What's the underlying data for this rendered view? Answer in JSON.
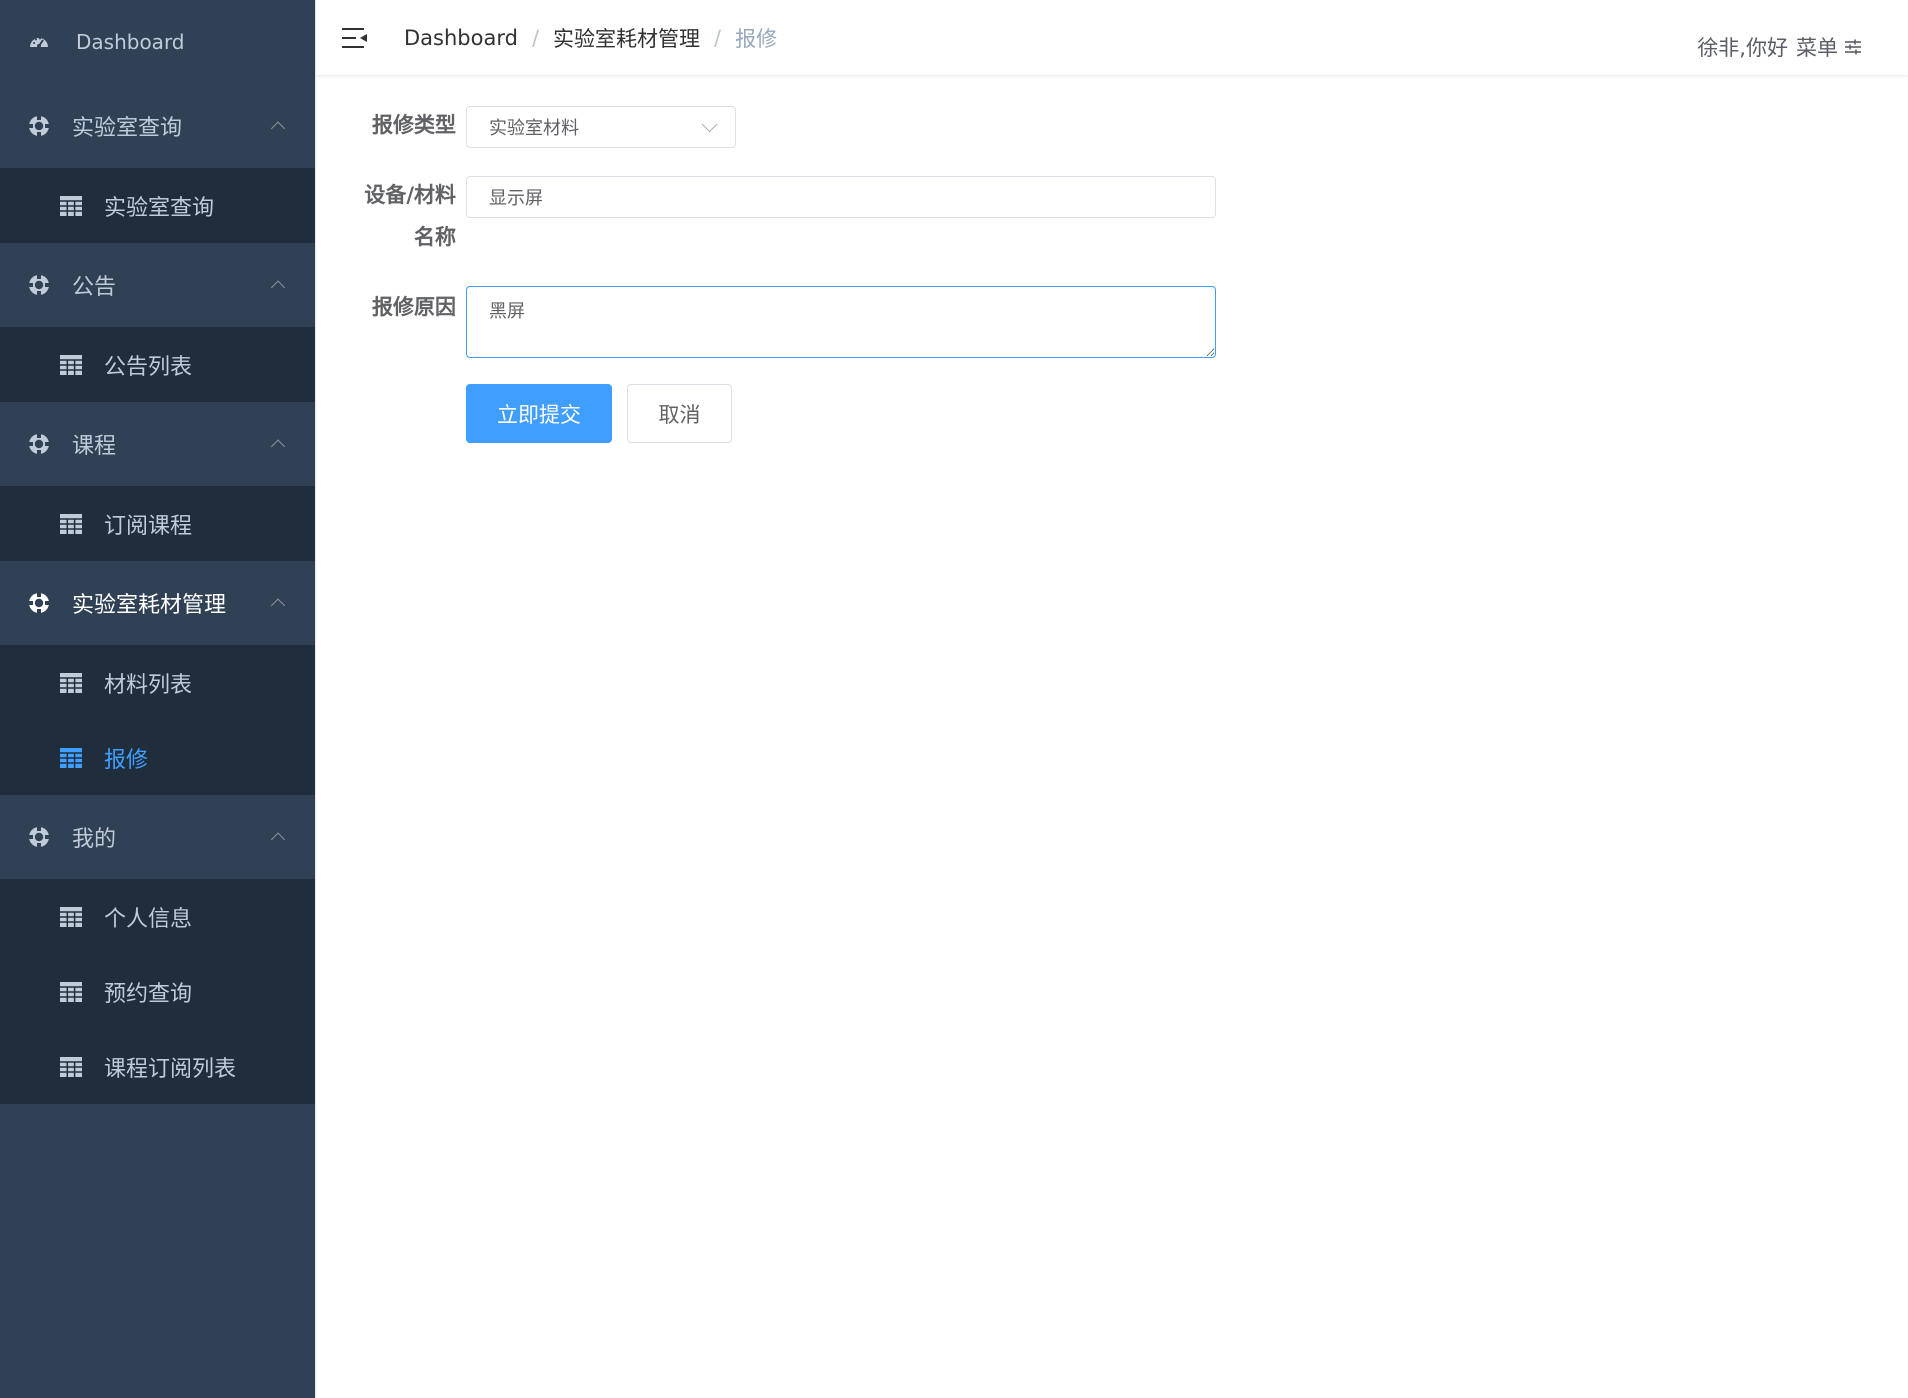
{
  "sidebar": {
    "top_item": {
      "label": "Dashboard",
      "icon": "dashboard-icon"
    },
    "groups": [
      {
        "label": "实验室查询",
        "icon": "life-ring-icon",
        "items": [
          {
            "label": "实验室查询",
            "icon": "table-icon"
          }
        ]
      },
      {
        "label": "公告",
        "icon": "life-ring-icon",
        "items": [
          {
            "label": "公告列表",
            "icon": "table-icon"
          }
        ]
      },
      {
        "label": "课程",
        "icon": "life-ring-icon",
        "items": [
          {
            "label": "订阅课程",
            "icon": "table-icon"
          }
        ]
      },
      {
        "label": "实验室耗材管理",
        "icon": "life-ring-icon",
        "items": [
          {
            "label": "材料列表",
            "icon": "table-icon"
          },
          {
            "label": "报修",
            "icon": "table-icon",
            "active": true
          }
        ]
      },
      {
        "label": "我的",
        "icon": "life-ring-icon",
        "items": [
          {
            "label": "个人信息",
            "icon": "table-icon"
          },
          {
            "label": "预约查询",
            "icon": "table-icon"
          },
          {
            "label": "课程订阅列表",
            "icon": "table-icon"
          }
        ]
      }
    ],
    "colors": {
      "background": "#304156",
      "submenu_background": "#1f2d3d",
      "text": "#bfcbd9",
      "active": "#409eff"
    }
  },
  "navbar": {
    "breadcrumb": [
      "Dashboard",
      "实验室耗材管理",
      "报修"
    ],
    "separator": "/",
    "user": {
      "greeting": "徐非,你好",
      "menu_label": "菜单"
    }
  },
  "form": {
    "type": {
      "label": "报修类型",
      "value": "实验室材料"
    },
    "name": {
      "label_line1": "设备/材料",
      "label_line2": "名称",
      "value": "显示屏"
    },
    "reason": {
      "label": "报修原因",
      "value": "黑屏"
    },
    "submit_label": "立即提交",
    "cancel_label": "取消"
  }
}
